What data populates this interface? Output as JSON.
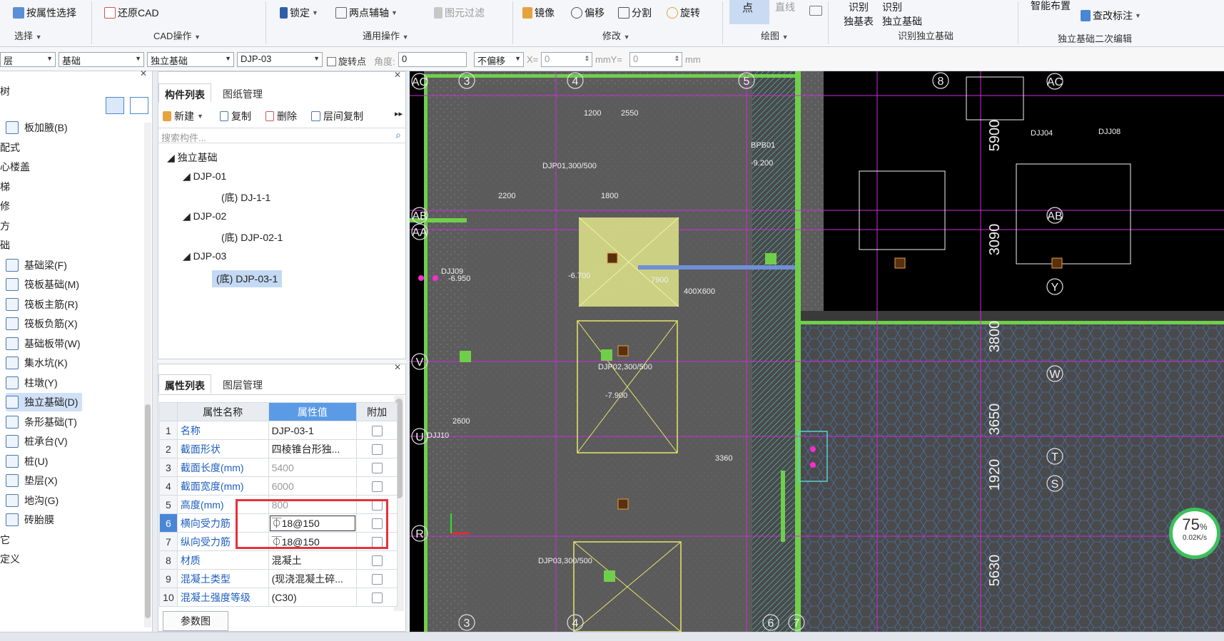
{
  "ribbon": {
    "select_by_attr": "按属性选择",
    "restore_cad": "还原CAD",
    "lock": "锁定",
    "two_point_axis": "两点辅轴",
    "element_filter": "图元过滤",
    "mirror": "镜像",
    "offset": "偏移",
    "split": "分割",
    "rotate": "旋转",
    "point": "点",
    "line": "直线",
    "identify_a": "识别",
    "identify_table": "独基表",
    "identify_b": "识别",
    "identify_found": "独立基础",
    "smart_layout": "智能布置",
    "check_label": "查改标注",
    "groups": {
      "select": "选择",
      "cad_ops": "CAD操作",
      "general_ops": "通用操作",
      "modify": "修改",
      "draw": "绘图",
      "identify_group": "识别独立基础",
      "secondary_edit": "独立基础二次编辑"
    }
  },
  "optbar": {
    "layer": "层",
    "category": "基础",
    "type": "独立基础",
    "name": "DJP-03",
    "rotate_point": "旋转点",
    "angle_label": "角度:",
    "angle_value": "0",
    "offset_mode": "不偏移",
    "x_label": "X=",
    "x_value": "0",
    "y_label": "mmY=",
    "y_value": "0",
    "mm": "mm"
  },
  "lefttree": {
    "header": "树",
    "items": [
      {
        "label": "板加腋(B)"
      },
      {
        "label": "配式"
      },
      {
        "label": "心楼盖"
      },
      {
        "label": "梯"
      },
      {
        "label": "修"
      },
      {
        "label": "方"
      },
      {
        "label": "础"
      },
      {
        "label": "基础梁(F)"
      },
      {
        "label": "筏板基础(M)"
      },
      {
        "label": "筏板主筋(R)"
      },
      {
        "label": "筏板负筋(X)"
      },
      {
        "label": "基础板带(W)"
      },
      {
        "label": "集水坑(K)"
      },
      {
        "label": "柱墩(Y)"
      },
      {
        "label": "独立基础(D)"
      },
      {
        "label": "条形基础(T)"
      },
      {
        "label": "桩承台(V)"
      },
      {
        "label": "桩(U)"
      },
      {
        "label": "垫层(X)"
      },
      {
        "label": "地沟(G)"
      },
      {
        "label": "砖胎膜"
      },
      {
        "label": "它"
      },
      {
        "label": "定义"
      }
    ]
  },
  "component_panel": {
    "tab_list": "构件列表",
    "tab_drawing": "图纸管理",
    "new": "新建",
    "copy": "复制",
    "delete": "删除",
    "floor_copy": "层间复制",
    "search_placeholder": "搜索构件...",
    "tree": {
      "root": "独立基础",
      "n1": "DJP-01",
      "n1c": "(底) DJ-1-1",
      "n2": "DJP-02",
      "n2c": "(底) DJP-02-1",
      "n3": "DJP-03",
      "n3c": "(底) DJP-03-1"
    }
  },
  "property_panel": {
    "tab_props": "属性列表",
    "tab_layers": "图层管理",
    "col_name": "属性名称",
    "col_value": "属性值",
    "col_extra": "附加",
    "rows": [
      {
        "n": "1",
        "name": "名称",
        "value": "DJP-03-1"
      },
      {
        "n": "2",
        "name": "截面形状",
        "value": "四棱锥台形独..."
      },
      {
        "n": "3",
        "name": "截面长度(mm)",
        "value": "5400"
      },
      {
        "n": "4",
        "name": "截面宽度(mm)",
        "value": "6000"
      },
      {
        "n": "5",
        "name": "高度(mm)",
        "value": "800"
      },
      {
        "n": "6",
        "name": "横向受力筋",
        "value": "⏁18@150"
      },
      {
        "n": "7",
        "name": "纵向受力筋",
        "value": "⏁18@150"
      },
      {
        "n": "8",
        "name": "材质",
        "value": "混凝土"
      },
      {
        "n": "9",
        "name": "混凝土类型",
        "value": "(现浇混凝土碎..."
      },
      {
        "n": "10",
        "name": "混凝土强度等级",
        "value": "(C30)"
      }
    ],
    "param_button": "参数图"
  },
  "cad": {
    "axes_top": [
      "3",
      "4",
      "5",
      "8"
    ],
    "axes_bottom": [
      "3",
      "4",
      "6",
      "7"
    ],
    "axes_left": [
      "AC",
      "AB",
      "AA",
      "V",
      "U",
      "R"
    ],
    "axes_right": [
      "AC",
      "AB",
      "Y",
      "W",
      "T",
      "S"
    ],
    "dims_right": [
      "5900",
      "3090",
      "3800",
      "3650",
      "1920",
      "5630"
    ],
    "labels": [
      "DJP01,300/500",
      "DJP02,300/500",
      "DJP03,300/500",
      "DJJ09",
      "DJJ10",
      "DJJ04",
      "DJJ08",
      "BPB01",
      "400X600",
      "3360",
      "7900",
      "2600",
      "2550",
      "1200",
      "1800",
      "2200",
      "-6.700",
      "-6.950",
      "-7.900",
      "-9.200"
    ]
  },
  "perf": {
    "percent": "75",
    "unit": "%",
    "rate": "0.02K/s"
  }
}
